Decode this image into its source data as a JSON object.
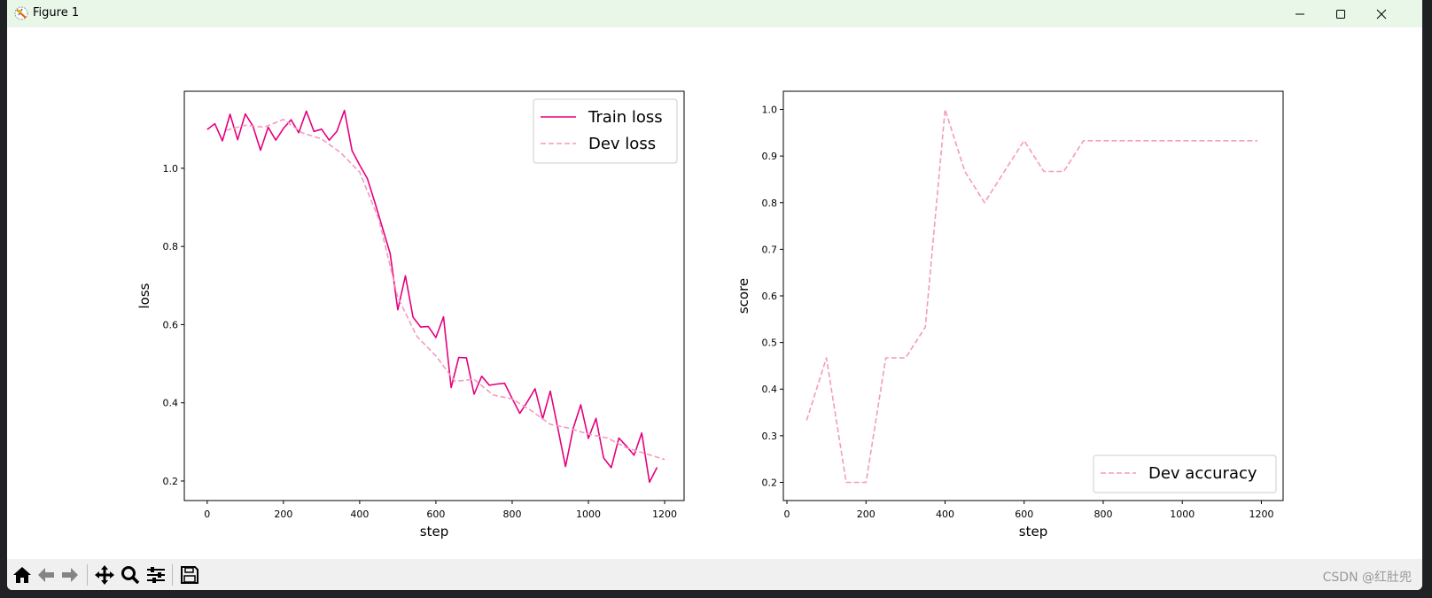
{
  "window": {
    "title": "Figure 1",
    "watermark": "CSDN @红肚兜"
  },
  "toolbar": {
    "icons": [
      "home-icon",
      "back-arrow-icon",
      "forward-arrow-icon",
      "pan-icon",
      "zoom-icon",
      "configure-subplots-icon",
      "save-icon"
    ]
  },
  "colors": {
    "train": "#e6007e",
    "dev": "#f49ac1"
  },
  "chart_data": [
    {
      "type": "line",
      "xlabel": "step",
      "ylabel": "loss",
      "xlim": [
        -60,
        1251
      ],
      "ylim": [
        0.15,
        1.197
      ],
      "xticks": [
        0,
        200,
        400,
        600,
        800,
        1000,
        1200
      ],
      "yticks": [
        0.2,
        0.4,
        0.6,
        0.8,
        1.0
      ],
      "ytick_labels": [
        "0.2",
        "0.4",
        "0.6",
        "0.8",
        "1.0"
      ],
      "grid": false,
      "legend": "top-right",
      "series": [
        {
          "name": "Train loss",
          "style": "solid",
          "x": [
            0,
            20,
            40,
            60,
            80,
            100,
            120,
            140,
            160,
            180,
            200,
            220,
            240,
            260,
            280,
            300,
            320,
            340,
            360,
            380,
            400,
            420,
            440,
            460,
            480,
            500,
            520,
            540,
            560,
            580,
            600,
            620,
            640,
            660,
            680,
            700,
            720,
            740,
            760,
            780,
            800,
            820,
            840,
            860,
            880,
            900,
            920,
            940,
            960,
            980,
            1000,
            1020,
            1040,
            1060,
            1080,
            1100,
            1120,
            1140,
            1160,
            1180
          ],
          "y": [
            1.099,
            1.114,
            1.07,
            1.138,
            1.073,
            1.139,
            1.108,
            1.046,
            1.105,
            1.072,
            1.102,
            1.124,
            1.091,
            1.146,
            1.094,
            1.1,
            1.072,
            1.094,
            1.148,
            1.045,
            1.008,
            0.974,
            0.912,
            0.847,
            0.782,
            0.638,
            0.725,
            0.619,
            0.594,
            0.595,
            0.567,
            0.62,
            0.439,
            0.516,
            0.515,
            0.422,
            0.468,
            0.445,
            0.448,
            0.45,
            0.411,
            0.373,
            0.403,
            0.436,
            0.359,
            0.43,
            0.334,
            0.237,
            0.334,
            0.395,
            0.309,
            0.36,
            0.259,
            0.234,
            0.31,
            0.289,
            0.266,
            0.323,
            0.197,
            0.235
          ]
        },
        {
          "name": "Dev loss",
          "style": "dashed",
          "x": [
            50,
            100,
            150,
            200,
            250,
            300,
            350,
            400,
            450,
            500,
            550,
            600,
            650,
            700,
            750,
            800,
            850,
            900,
            950,
            1000,
            1050,
            1100,
            1150,
            1200
          ],
          "y": [
            1.097,
            1.11,
            1.105,
            1.125,
            1.09,
            1.075,
            1.04,
            0.99,
            0.87,
            0.67,
            0.57,
            0.52,
            0.455,
            0.46,
            0.42,
            0.41,
            0.38,
            0.345,
            0.335,
            0.32,
            0.31,
            0.285,
            0.27,
            0.255
          ]
        }
      ]
    },
    {
      "type": "line",
      "xlabel": "step",
      "ylabel": "score",
      "xlim": [
        -9,
        1255
      ],
      "ylim": [
        0.161,
        1.039
      ],
      "xticks": [
        0,
        200,
        400,
        600,
        800,
        1000,
        1200
      ],
      "yticks": [
        0.2,
        0.3,
        0.4,
        0.5,
        0.6,
        0.7,
        0.8,
        0.9,
        1.0
      ],
      "ytick_labels": [
        "0.2",
        "0.3",
        "0.4",
        "0.5",
        "0.6",
        "0.7",
        "0.8",
        "0.9",
        "1.0"
      ],
      "grid": false,
      "legend": "bottom-right",
      "series": [
        {
          "name": "Dev accuracy",
          "style": "dashed",
          "x": [
            50,
            100,
            150,
            200,
            250,
            300,
            350,
            400,
            450,
            500,
            550,
            600,
            650,
            700,
            750,
            800,
            850,
            900,
            950,
            1000,
            1050,
            1100,
            1150,
            1190
          ],
          "y": [
            0.333,
            0.467,
            0.2,
            0.2,
            0.467,
            0.467,
            0.533,
            1.0,
            0.867,
            0.8,
            0.867,
            0.933,
            0.867,
            0.867,
            0.933,
            0.933,
            0.933,
            0.933,
            0.933,
            0.933,
            0.933,
            0.933,
            0.933,
            0.933
          ]
        }
      ]
    }
  ]
}
